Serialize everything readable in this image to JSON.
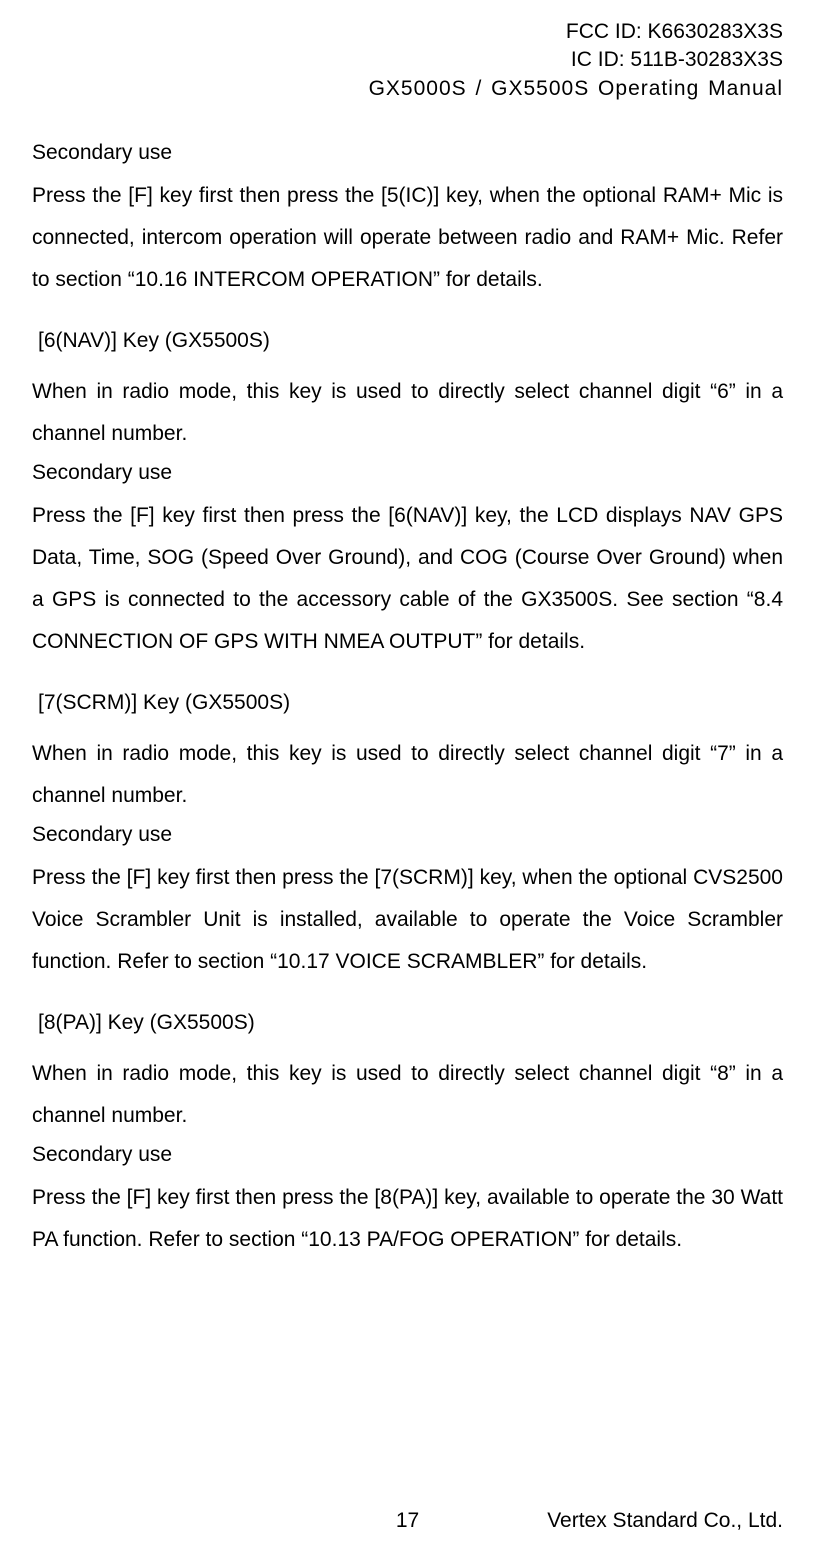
{
  "header": {
    "fcc": "FCC ID: K6630283X3S",
    "ic": "IC ID: 511B-30283X3S",
    "model": "GX5000S / GX5500S  Operating Manual"
  },
  "sections": {
    "sec0": {
      "label": "Secondary use",
      "body": "Press the [F] key first then press the [5(IC)] key, when the optional RAM+ Mic is connected, intercom operation will operate between radio and RAM+ Mic. Refer to section “10.16 INTERCOM OPERATION” for details."
    },
    "key6": {
      "heading": "[6(NAV)] Key (GX5500S)",
      "body1": "When in radio mode, this key is used to directly select channel digit “6” in a channel number.",
      "label": "Secondary use",
      "body2": "Press the [F] key first then press the [6(NAV)] key, the LCD displays NAV GPS Data, Time, SOG (Speed Over Ground), and COG (Course Over Ground) when a GPS is connected to the accessory cable of the GX3500S. See section “8.4 CONNECTION OF GPS WITH NMEA OUTPUT” for details."
    },
    "key7": {
      "heading": "[7(SCRM)] Key (GX5500S)",
      "body1": "When in radio mode, this key is used to directly select channel digit “7” in a channel number.",
      "label": "Secondary use",
      "body2": "Press the [F] key first then press the [7(SCRM)] key, when the optional CVS2500 Voice Scrambler Unit is installed, available to operate the Voice Scrambler function. Refer to section “10.17 VOICE SCRAMBLER” for details."
    },
    "key8": {
      "heading": "[8(PA)] Key (GX5500S)",
      "body1": "When in radio mode, this key is used to directly select channel digit “8” in a channel number.",
      "label": "Secondary use",
      "body2": "Press the [F] key first then press the [8(PA)] key, available to operate the 30 Watt PA function. Refer to section “10.13 PA/FOG OPERATION” for details."
    }
  },
  "footer": {
    "page": "17",
    "company": "Vertex Standard Co., Ltd."
  }
}
